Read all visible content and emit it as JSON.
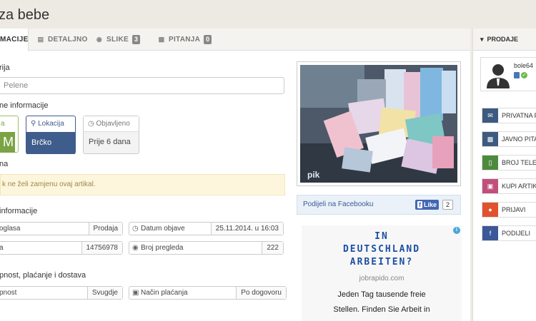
{
  "page": {
    "title": "za bebe"
  },
  "tabs": [
    {
      "label": "MACIJE",
      "icon": "info-icon",
      "active": true
    },
    {
      "label": "DETALJNO",
      "icon": "document-icon"
    },
    {
      "label": "SLIKE",
      "icon": "camera-icon",
      "count": "3"
    },
    {
      "label": "PITANJA",
      "icon": "chat-icon",
      "count": "0"
    }
  ],
  "category": {
    "label": "rija",
    "value": "Pelene"
  },
  "main_info": {
    "label": "ne informacije",
    "card1": {
      "label": "a",
      "value": "M"
    },
    "location": {
      "label": "Lokacija",
      "value": "Brčko"
    },
    "published": {
      "label": "Objavljeno",
      "value": "Prije 6 dana"
    }
  },
  "exchange": {
    "label": "na",
    "notice": "k ne želi zamjenu ovaj artikal."
  },
  "other_info": {
    "label": "informacije",
    "rows": [
      {
        "key": "oglasa",
        "value": "Prodaja"
      },
      {
        "key": "Datum objave",
        "value": "25.11.2014. u 16:03"
      },
      {
        "key": "a",
        "value": "14756978"
      },
      {
        "key": "Broj pregleda",
        "value": "222"
      }
    ]
  },
  "payment": {
    "label": "pnost, plaćanje i dostava",
    "rows": [
      {
        "key": "pnost",
        "value": "Svugdje"
      },
      {
        "key": "Način plaćanja",
        "value": "Po dogovoru"
      }
    ]
  },
  "photo": {
    "watermark": "pik"
  },
  "facebook": {
    "share_label": "Podijeli na Facebooku",
    "like_label": "Like",
    "like_count": "2"
  },
  "ad": {
    "line1": "IN",
    "line2": "DEUTSCHLAND",
    "line3": "ARBEITEN?",
    "domain": "jobrapido.com",
    "text1": "Jeden Tag tausende freie",
    "text2": "Stellen. Finden Sie Arbeit in"
  },
  "sidebar": {
    "header": "PRODAJE",
    "user": {
      "name": "bole64"
    },
    "buttons": [
      {
        "label": "PRIVATNA P",
        "color": "#3d5a80"
      },
      {
        "label": "JAVNO PITA",
        "color": "#3d5a80"
      },
      {
        "label": "BROJ TELEF",
        "color": "#4e8a3e"
      },
      {
        "label": "KUPI ARTIKA",
        "color": "#c0507a"
      },
      {
        "label": "PRIJAVI",
        "color": "#e0532e"
      },
      {
        "label": "PODIJELI",
        "color": "#3b5998"
      }
    ]
  },
  "colors": {
    "accent": "#3d5a80",
    "location_card": "#3f5d8c",
    "card_green": "#7aa344"
  }
}
